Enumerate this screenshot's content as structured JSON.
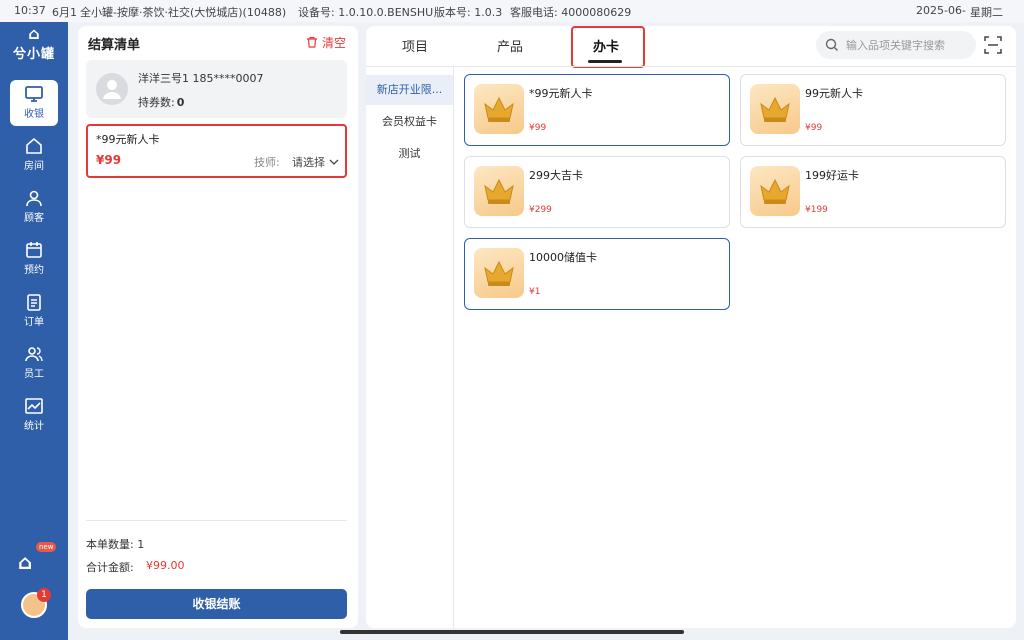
{
  "status_bar": {
    "time": "10:37",
    "date_short": "6月1",
    "store": "全小罐-按摩·茶饮·社交(大悦城店)(10488)",
    "device": "设备号: 1.0.10.0.BENSHU",
    "version": "版本号: 1.0.3",
    "service_phone": "客服电话: 4000080629",
    "datetime": "2025-06-",
    "weekday": "星期二"
  },
  "sidebar": {
    "logo_text": "兮小罐",
    "items": [
      {
        "label": "收银",
        "icon": "monitor-icon"
      },
      {
        "label": "房间",
        "icon": "home-icon"
      },
      {
        "label": "顾客",
        "icon": "person-icon"
      },
      {
        "label": "预约",
        "icon": "calendar-icon"
      },
      {
        "label": "订单",
        "icon": "clipboard-icon"
      },
      {
        "label": "员工",
        "icon": "group-icon"
      },
      {
        "label": "统计",
        "icon": "chart-icon"
      }
    ],
    "promo_new": "new",
    "avatar_badge": "1"
  },
  "checkout": {
    "title": "结算清单",
    "clear_label": "清空",
    "member_name": "洋洋三号1 185****0007",
    "coupon_label": "持券数:",
    "coupon_count": "0",
    "cart_item": {
      "name": "*99元新人卡",
      "price": "¥99",
      "tech_label": "技师:",
      "tech_select": "请选择"
    },
    "qty_text": "本单数量: 1",
    "total_label": "合计金额:",
    "total_value": "¥99.00",
    "checkout_button": "收银结账"
  },
  "main": {
    "tabs": [
      "项目",
      "产品",
      "办卡"
    ],
    "search_placeholder": "输入品项关键字搜索",
    "categories": [
      "新店开业限...",
      "会员权益卡",
      "测试"
    ],
    "cards": [
      {
        "title": "*99元新人卡",
        "price": "¥99"
      },
      {
        "title": "99元新人卡",
        "price": "¥99"
      },
      {
        "title": "299大吉卡",
        "price": "¥299"
      },
      {
        "title": "199好运卡",
        "price": "¥199"
      },
      {
        "title": "10000储值卡",
        "price": "¥1"
      }
    ]
  },
  "colors": {
    "sidebar": "#2f5fa8",
    "accent_red": "#e53935",
    "primary_button": "#2f5fa8"
  }
}
